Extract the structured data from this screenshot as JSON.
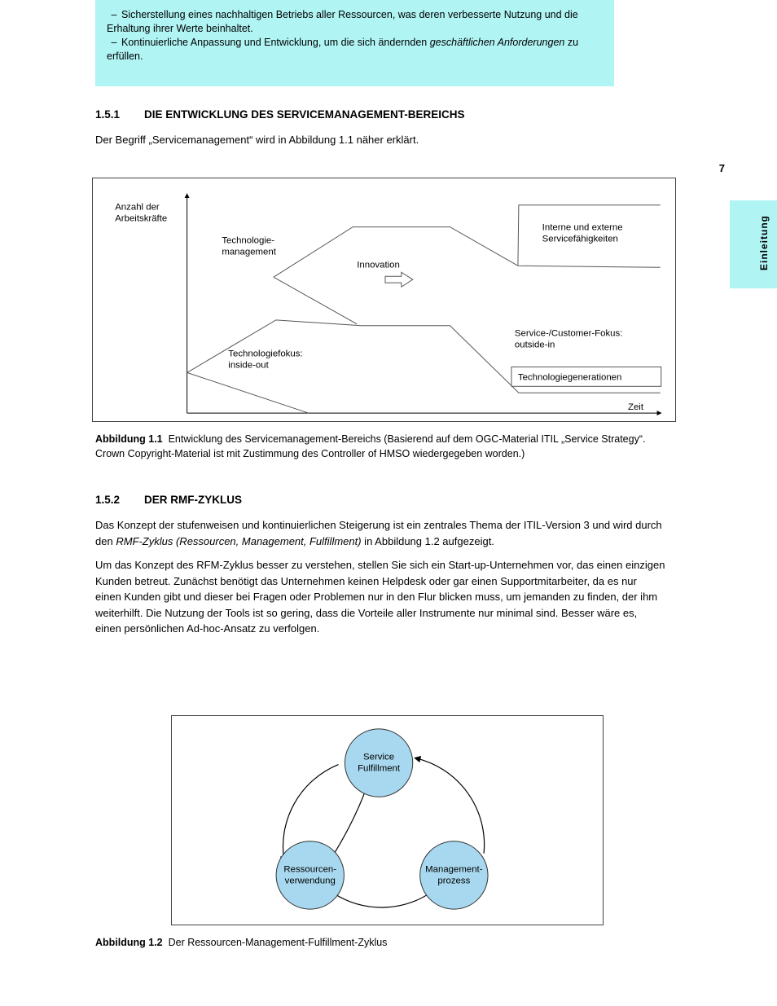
{
  "topbox": {
    "line1_dash": "–",
    "line1": "Sicherstellung eines nachhaltigen Betriebs aller Ressourcen, was deren verbesserte Nutzung und die Erhaltung ihrer Werte beinhaltet.",
    "line2_dash": "–",
    "line2_prefix": "Kontinuierliche Anpassung und Entwicklung, um die sich ändernden ",
    "line2_em": "geschäftlichen Anforderungen",
    "line2_suffix": " zu erfüllen."
  },
  "header": {
    "num": "1.5.1",
    "title": "DIE ENTWICKLUNG DES SERVICEMANAGEMENT-BEREICHS"
  },
  "intro": "Der Begriff „Servicemanagement“ wird in Abbildung 1.1 näher erklärt.",
  "fig1": {
    "ylabel_line1": "Anzahl der",
    "ylabel_line2": "Arbeitskräfte",
    "arrow_caption": "Innovation",
    "top_left": "Technologie-",
    "top_left2": "management",
    "top_right": "Interne und externe",
    "top_right2": "Servicefähigkeiten",
    "bottom_left": "Technologiefokus:",
    "bottom_left2": "inside-out",
    "bottom_right": "Service-/Customer-Fokus:",
    "bottom_right2": "outside-in",
    "legend": "Technologiegenerationen",
    "xlabel": "Zeit"
  },
  "fig1_caption_prefix": "Abbildung 1.1",
  "fig1_caption": "Entwicklung des Servicemanagement-Bereichs (Basierend auf dem OGC-Material ITIL „Service Strategy“. Crown Copyright-Material ist mit Zustimmung des Controller of HMSO wiedergegeben worden.)",
  "sec2": {
    "num": "1.5.2",
    "title": "DER RMF-ZYKLUS"
  },
  "body2": {
    "p1_prefix": "Das Konzept der stufenweisen und kontinuierlichen Steigerung ist ein zentrales Thema der ITIL-Version 3 und wird durch den ",
    "p1_em": "RMF-Zyklus (Ressourcen, Management, Fulfillment)",
    "p1_suffix": " in Abbildung 1.2 aufgezeigt.",
    "p2": "Um das Konzept des RFM-Zyklus besser zu verstehen, stellen Sie sich ein Start-up-Unternehmen vor, das einen einzigen Kunden betreut. Zunächst benötigt das Unternehmen keinen Helpdesk oder gar einen Supportmitarbeiter, da es nur einen Kunden gibt und dieser bei Fragen oder Problemen nur in den Flur blicken muss, um jemanden zu finden, der ihm weiterhilft. Die Nutzung der Tools ist so gering, dass die Vorteile aller Instrumente nur minimal sind. Besser wäre es, einen persönlichen Ad-hoc-Ansatz zu verfolgen."
  },
  "fig2": {
    "top_label1": "Service",
    "top_label2": "Fulfillment",
    "left_label1": "Ressourcen-",
    "left_label2": "verwendung",
    "right_label1": "Management-",
    "right_label2": "prozess"
  },
  "fig2_caption_prefix": "Abbildung 1.2",
  "fig2_caption": "Der Ressourcen-Management-Fulfillment-Zyklus",
  "side": "Einleitung",
  "pagenum": "7"
}
